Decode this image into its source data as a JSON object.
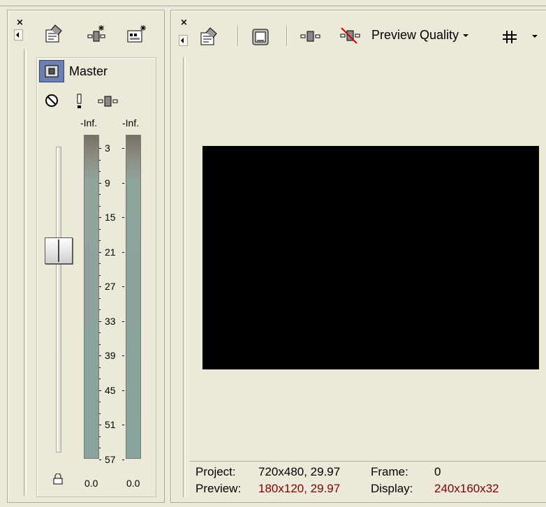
{
  "mixer": {
    "bus_name": "Master",
    "peak_left": "-Inf.",
    "peak_right": "-Inf.",
    "scale": [
      "3",
      "9",
      "15",
      "21",
      "27",
      "33",
      "39",
      "45",
      "51",
      "57"
    ],
    "level_left": "0.0",
    "level_right": "0.0"
  },
  "preview": {
    "quality_label": "Preview Quality",
    "project_label": "Project:",
    "project_value": "720x480, 29.97",
    "frame_label": "Frame:",
    "frame_value": "0",
    "preview_label": "Preview:",
    "preview_value": "180x120, 29.97",
    "display_label": "Display:",
    "display_value": "240x160x32"
  },
  "colors": {
    "background": "#ece9d8",
    "status_highlight": "#800000",
    "preview_area": "#000000"
  },
  "icons": [
    "close-icon",
    "collapse-left-icon",
    "properties-icon",
    "insert-bus-icon",
    "insert-assignable-fx-icon",
    "bus-icon",
    "mute-icon",
    "solo-icon",
    "fx-icon",
    "preview-settings-icon",
    "split-screen-icon",
    "video-fx-icon",
    "remove-fx-icon",
    "grid-overlay-icon",
    "lock-icon"
  ]
}
